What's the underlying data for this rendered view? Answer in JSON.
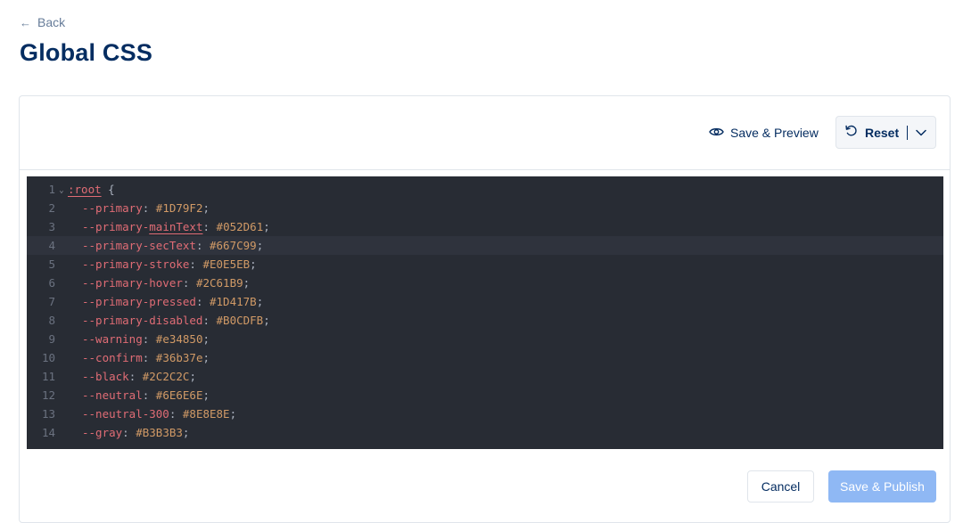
{
  "nav": {
    "back_label": "Back"
  },
  "page": {
    "title": "Global CSS"
  },
  "toolbar": {
    "preview_label": "Save & Preview",
    "reset_label": "Reset"
  },
  "footer": {
    "cancel_label": "Cancel",
    "publish_label": "Save & Publish"
  },
  "editor": {
    "active_line": 4,
    "lines": [
      {
        "num": "1",
        "selector": ":root",
        "brace": " {"
      },
      {
        "num": "2",
        "prop": "--primary",
        "value": "#1D79F2"
      },
      {
        "num": "3",
        "prop_pre": "--primary-",
        "prop_ul": "mainText",
        "value": "#052D61"
      },
      {
        "num": "4",
        "prop": "--primary-secText",
        "value": "#667C99"
      },
      {
        "num": "5",
        "prop": "--primary-stroke",
        "value": "#E0E5EB"
      },
      {
        "num": "6",
        "prop": "--primary-hover",
        "value": "#2C61B9"
      },
      {
        "num": "7",
        "prop": "--primary-pressed",
        "value": "#1D417B"
      },
      {
        "num": "8",
        "prop": "--primary-disabled",
        "value": "#B0CDFB"
      },
      {
        "num": "9",
        "prop": "--warning",
        "value": "#e34850"
      },
      {
        "num": "10",
        "prop": "--confirm",
        "value": "#36b37e"
      },
      {
        "num": "11",
        "prop": "--black",
        "value": "#2C2C2C"
      },
      {
        "num": "12",
        "prop": "--neutral",
        "value": "#6E6E6E"
      },
      {
        "num": "13",
        "prop": "--neutral-300",
        "value": "#8E8E8E"
      },
      {
        "num": "14",
        "prop": "--gray",
        "value": "#B3B3B3"
      }
    ]
  },
  "colors": {
    "title": "#052D61",
    "secondary_text": "#667C99",
    "border": "#E0E5EB",
    "editor_bg": "#282C34",
    "publish_button_disabled": "#8FB8F4"
  },
  "icons": {
    "back": "arrow-left-icon",
    "preview": "eye-icon",
    "reset": "rotate-ccw-icon",
    "dropdown": "chevron-down-icon",
    "fold": "fold-chevron-icon"
  }
}
